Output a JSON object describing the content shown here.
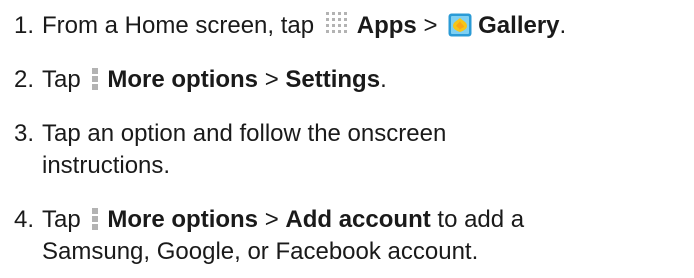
{
  "steps": [
    {
      "number": "1.",
      "t1": "From a Home screen, tap",
      "b1": "Apps",
      "t2": " > ",
      "b2": "Gallery",
      "t3": "."
    },
    {
      "number": "2.",
      "t1": "Tap",
      "b1": "More options",
      "t2": " > ",
      "b2": "Settings",
      "t3": "."
    },
    {
      "number": "3.",
      "line1": "Tap an option and follow the onscreen",
      "line2": "instructions."
    },
    {
      "number": "4.",
      "t1": "Tap",
      "b1": "More options",
      "t2": " > ",
      "b2": "Add account",
      "t3": " to add a",
      "line2": "Samsung, Google, or Facebook account."
    }
  ],
  "icons": {
    "apps": "apps-grid-icon",
    "gallery": "gallery-icon",
    "more": "more-options-icon"
  },
  "colors": {
    "text": "#1a1a1a",
    "icon_gray": "#b3b3b3",
    "gallery_blue": "#2b9bd6",
    "gallery_yellow": "#f5c518"
  }
}
